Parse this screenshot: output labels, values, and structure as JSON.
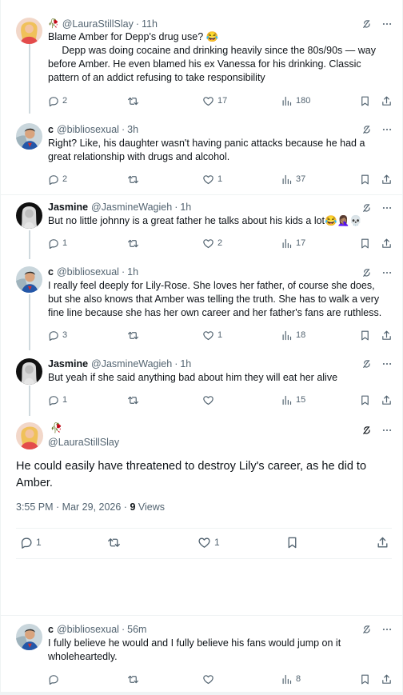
{
  "colors": {
    "text": "#0f1419",
    "muted": "#536471",
    "border": "#eff3f4",
    "badge": "#d6352a"
  },
  "replies": [
    {
      "name": "",
      "badge": "🥀",
      "handle": "@LauraStillSlay",
      "sep": "·",
      "time": "11h",
      "text": "Blame Amber for Depp's drug use? 😂\n     Depp was doing cocaine and drinking heavily since the 80s/90s — way before Amber. He even blamed his ex Vanessa for his drinking. Classic pattern of an addict refusing to take responsibility",
      "replies": "2",
      "reposts": "",
      "likes": "17",
      "views": "180"
    },
    {
      "name": "c",
      "badge": "",
      "handle": "@bibliosexual",
      "sep": "·",
      "time": "3h",
      "text": "Right? Like, his daughter wasn't having panic attacks because he had a great relationship with drugs and alcohol.",
      "replies": "2",
      "reposts": "",
      "likes": "1",
      "views": "37"
    },
    {
      "name": "Jasmine",
      "badge": "",
      "handle": "@JasmineWagieh",
      "sep": "·",
      "time": "1h",
      "text": "But no little johnny is a great father he talks about his kids a lot😂🤦🏽‍♀️💀",
      "replies": "1",
      "reposts": "",
      "likes": "2",
      "views": "17"
    },
    {
      "name": "c",
      "badge": "",
      "handle": "@bibliosexual",
      "sep": "·",
      "time": "1h",
      "text": "I really feel deeply for Lily-Rose. She loves her father, of course she does, but she also knows that Amber was telling the truth. She has to walk a very fine line because she has her own career and her father's fans are ruthless.",
      "replies": "3",
      "reposts": "",
      "likes": "1",
      "views": "18"
    },
    {
      "name": "Jasmine",
      "badge": "",
      "handle": "@JasmineWagieh",
      "sep": "·",
      "time": "1h",
      "text": "But yeah if she said anything bad about him they will eat her alive",
      "replies": "1",
      "reposts": "",
      "likes": "",
      "views": "15"
    }
  ],
  "main_post": {
    "badge": "🥀",
    "handle": "@LauraStillSlay",
    "text": "He could easily have threatened to destroy Lily's career, as he did to Amber.",
    "timestamp": "3:55 PM · Mar 29, 2026 · ",
    "views_count": "9",
    "views_label": " Views",
    "replies": "1",
    "likes": "1"
  },
  "last_reply": {
    "name": "c",
    "handle": "@bibliosexual",
    "sep": "·",
    "time": "56m",
    "text": "I fully believe he would and I fully believe his fans would jump on it wholeheartedly.",
    "views": "8"
  },
  "icons": [
    "grok-icon",
    "more-icon",
    "reply-icon",
    "repost-icon",
    "like-icon",
    "views-icon",
    "bookmark-icon",
    "share-icon"
  ]
}
